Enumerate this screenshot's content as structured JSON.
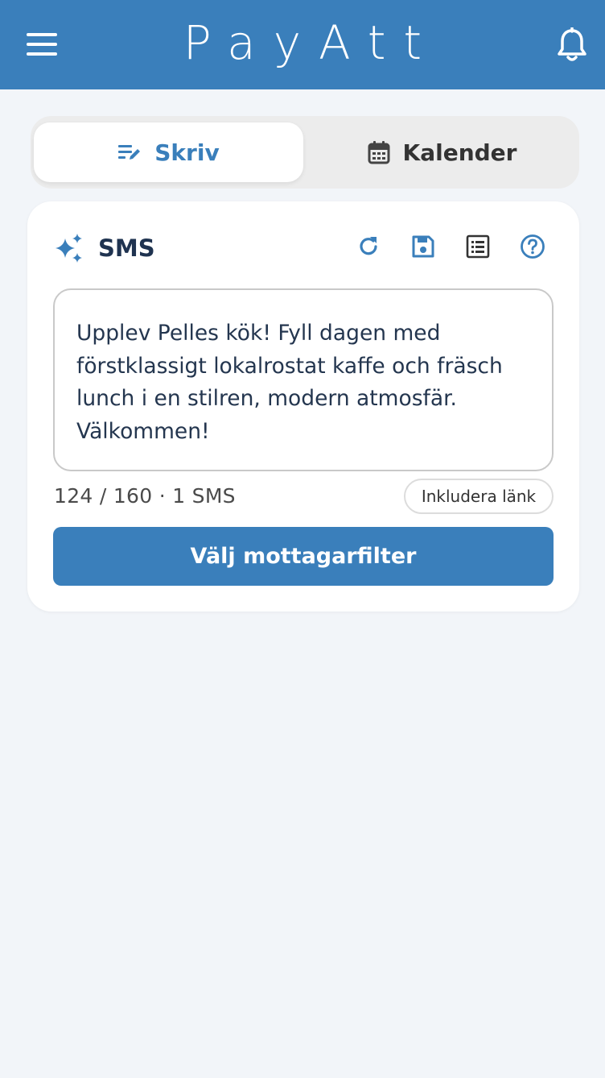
{
  "header": {
    "title": "PayAtt",
    "menu_icon": "hamburger-menu-icon",
    "bell_icon": "bell-icon",
    "color": "#3a7fbb"
  },
  "tabs": [
    {
      "label": "Skriv",
      "icon": "edit-lines-icon",
      "active": true
    },
    {
      "label": "Kalender",
      "icon": "calendar-icon",
      "active": false
    }
  ],
  "card": {
    "title": "SMS",
    "title_icon": "sparkles-icon",
    "tools": [
      "refresh-icon",
      "save-icon",
      "list-icon",
      "help-icon"
    ],
    "message": "Upplev Pelles kök! Fyll dagen med förstklassigt lokalrostat kaffe och fräsch lunch i en stilren, modern atmosfär. Välkommen!",
    "counter": "124 / 160 · 1 SMS",
    "include_link_label": "Inkludera länk",
    "primary_button_label": "Välj mottagarfilter"
  },
  "colors": {
    "accent": "#3a7fbb",
    "background": "#f2f5f9",
    "text_dark": "#1f3350"
  }
}
